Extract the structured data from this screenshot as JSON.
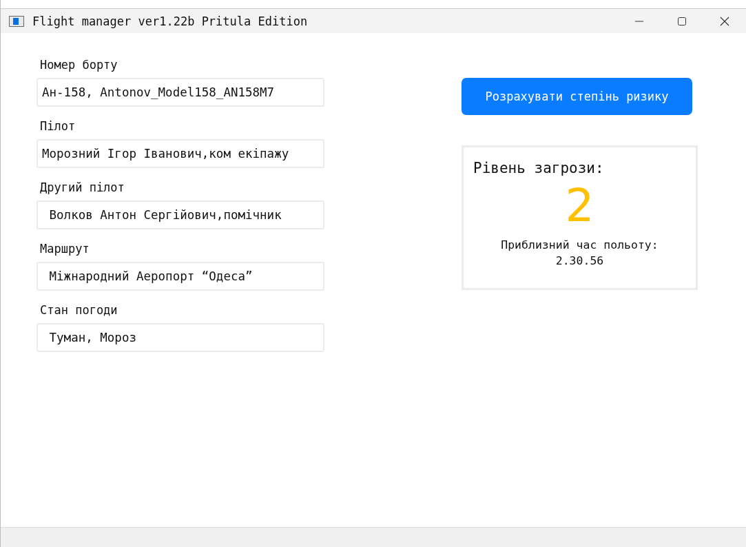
{
  "window": {
    "title": "Flight manager ver1.22b Pritula Edition"
  },
  "fields": [
    {
      "label": "Номер борту",
      "value": "Ан-158, Antonov_Model158_AN158M7"
    },
    {
      "label": "Пілот",
      "value": "Морозний Ігор Іванович,ком екіпажу"
    },
    {
      "label": "Другий пілот",
      "value": " Волков Антон Сергійович,помічник"
    },
    {
      "label": "Маршрут",
      "value": " Міжнародний Аеропорт “Одеса”"
    },
    {
      "label": "Стан погоди",
      "value": " Туман, Мороз"
    }
  ],
  "calculate_button": "Розрахувати степінь ризику",
  "risk": {
    "title": "Рівень загрози:",
    "level_value": "2",
    "color": "#ffc000",
    "flight_time_label": "Приблизний час польоту:",
    "flight_time": "2.30.56"
  }
}
